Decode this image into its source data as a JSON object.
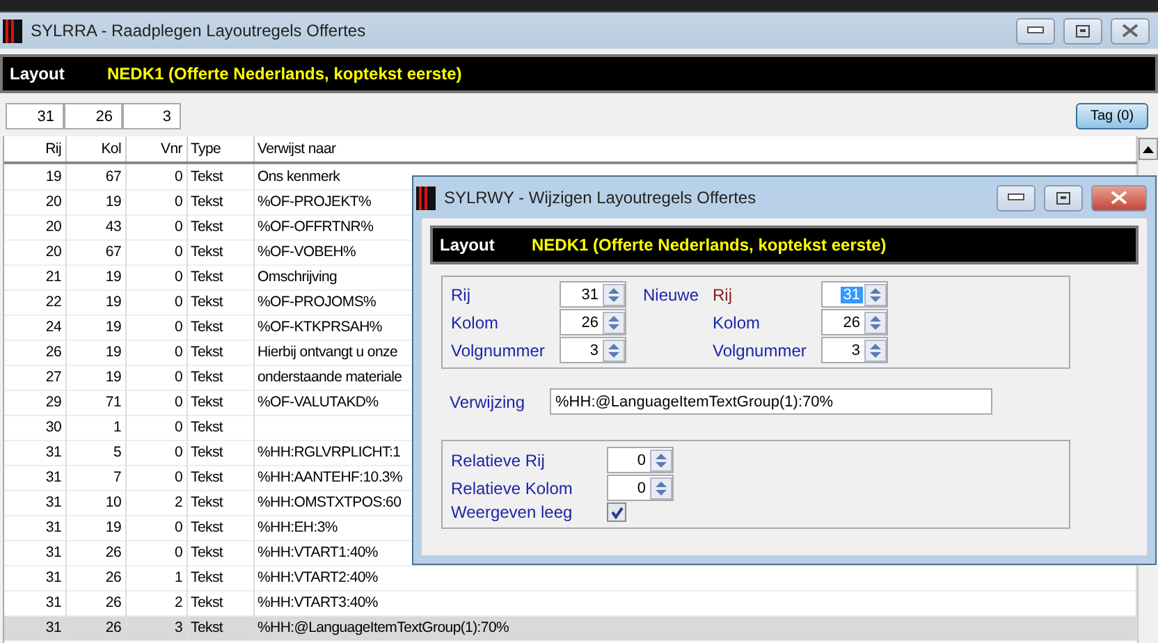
{
  "window": {
    "title": "SYLRRA - Raadplegen Layoutregels Offertes"
  },
  "layout": {
    "label": "Layout",
    "value": "NEDK1  (Offerte Nederlands, koptekst eerste)"
  },
  "filters": [
    "31",
    "26",
    "3"
  ],
  "tag_button": "Tag (0)",
  "table": {
    "columns": [
      "Rij",
      "Kol",
      "Vnr",
      "Type",
      "Verwijst naar"
    ],
    "rows": [
      {
        "cells": [
          "19",
          "67",
          "0",
          "Tekst",
          "Ons kenmerk"
        ],
        "selected": false
      },
      {
        "cells": [
          "20",
          "19",
          "0",
          "Tekst",
          "%OF-PROJEKT%"
        ],
        "selected": false
      },
      {
        "cells": [
          "20",
          "43",
          "0",
          "Tekst",
          "%OF-OFFRTNR%"
        ],
        "selected": false
      },
      {
        "cells": [
          "20",
          "67",
          "0",
          "Tekst",
          "%OF-VOBEH%"
        ],
        "selected": false
      },
      {
        "cells": [
          "21",
          "19",
          "0",
          "Tekst",
          "Omschrijving"
        ],
        "selected": false
      },
      {
        "cells": [
          "22",
          "19",
          "0",
          "Tekst",
          "%OF-PROJOMS%"
        ],
        "selected": false
      },
      {
        "cells": [
          "24",
          "19",
          "0",
          "Tekst",
          "%OF-KTKPRSAH%"
        ],
        "selected": false
      },
      {
        "cells": [
          "26",
          "19",
          "0",
          "Tekst",
          "Hierbij ontvangt u onze"
        ],
        "selected": false
      },
      {
        "cells": [
          "27",
          "19",
          "0",
          "Tekst",
          "onderstaande materiale"
        ],
        "selected": false
      },
      {
        "cells": [
          "29",
          "71",
          "0",
          "Tekst",
          "%OF-VALUTAKD%"
        ],
        "selected": false
      },
      {
        "cells": [
          "30",
          "1",
          "0",
          "Tekst",
          ""
        ],
        "selected": false
      },
      {
        "cells": [
          "31",
          "5",
          "0",
          "Tekst",
          "%HH:RGLVRPLICHT:1"
        ],
        "selected": false
      },
      {
        "cells": [
          "31",
          "7",
          "0",
          "Tekst",
          "%HH:AANTEHF:10.3%"
        ],
        "selected": false
      },
      {
        "cells": [
          "31",
          "10",
          "2",
          "Tekst",
          "%HH:OMSTXTPOS:60"
        ],
        "selected": false
      },
      {
        "cells": [
          "31",
          "19",
          "0",
          "Tekst",
          "%HH:EH:3%"
        ],
        "selected": false
      },
      {
        "cells": [
          "31",
          "26",
          "0",
          "Tekst",
          "%HH:VTART1:40%"
        ],
        "selected": false
      },
      {
        "cells": [
          "31",
          "26",
          "1",
          "Tekst",
          "%HH:VTART2:40%"
        ],
        "selected": false
      },
      {
        "cells": [
          "31",
          "26",
          "2",
          "Tekst",
          "%HH:VTART3:40%"
        ],
        "selected": false
      },
      {
        "cells": [
          "31",
          "26",
          "3",
          "Tekst",
          "%HH:@LanguageItemTextGroup(1):70%"
        ],
        "selected": true
      }
    ]
  },
  "dialog": {
    "title": "SYLRWY - Wijzigen Layoutregels Offertes",
    "layout": {
      "label": "Layout",
      "value": "NEDK1  (Offerte Nederlands, koptekst eerste)"
    },
    "new_label": "Nieuwe",
    "current": [
      {
        "label": "Rij",
        "value": "31",
        "focused": false
      },
      {
        "label": "Kolom",
        "value": "26",
        "focused": false
      },
      {
        "label": "Volgnummer",
        "value": "3",
        "focused": false
      }
    ],
    "new": [
      {
        "label": "Rij",
        "value": "31",
        "focused": true
      },
      {
        "label": "Kolom",
        "value": "26",
        "focused": false
      },
      {
        "label": "Volgnummer",
        "value": "3",
        "focused": false
      }
    ],
    "reference": {
      "label": "Verwijzing",
      "value": "%HH:@LanguageItemTextGroup(1):70%"
    },
    "relative": [
      {
        "label": "Relatieve Rij",
        "value": "0"
      },
      {
        "label": "Relatieve Kolom",
        "value": "0"
      }
    ],
    "show_empty": {
      "label": "Weergeven leeg",
      "checked": true
    }
  }
}
